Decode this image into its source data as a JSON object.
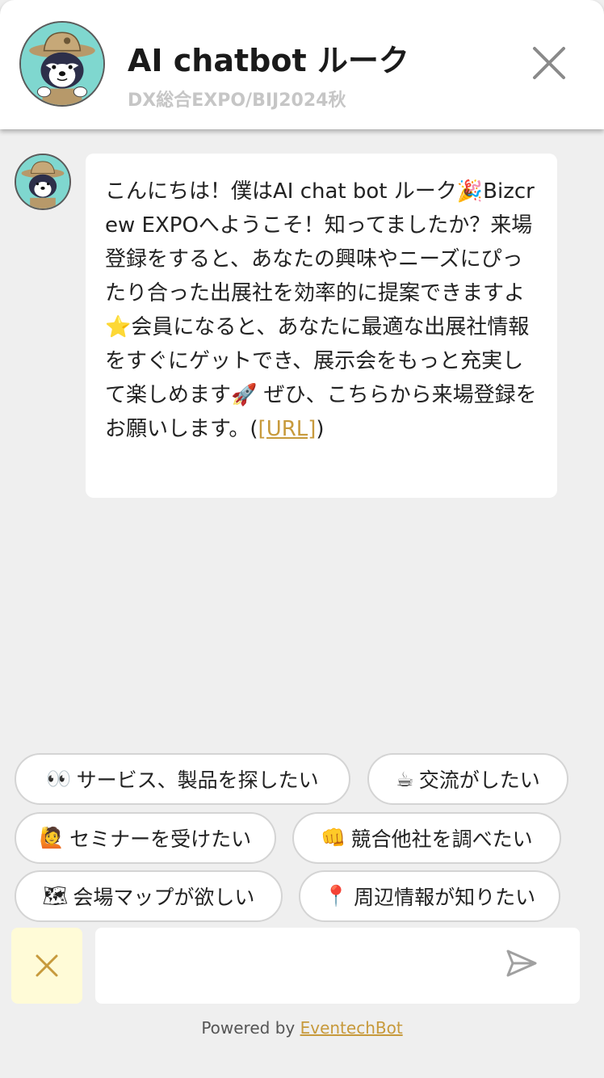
{
  "header": {
    "title": "AI chatbot ルーク",
    "subtitle": "DX総合EXPO/BIJ2024秋",
    "avatar_colors": {
      "background": "#7fd7cf",
      "hat": "#b7996a"
    }
  },
  "message": {
    "text_before_link": "こんにちは！僕はAI chat bot ルーク🎉Bizcrew EXPOへようこそ！知ってましたか？来場登録をすると、あなたの興味やニーズにぴったり合った出展社を効率的に提案できますよ⭐会員になると、あなたに最適な出展社情報をすぐにゲットでき、展示会をもっと充実して楽しめます🚀 ぜひ、こちらから来場登録をお願いします。(",
    "link_text": "[URL]",
    "text_after_link": ")"
  },
  "quick_replies": [
    {
      "emoji": "👀",
      "label": "サービス、製品を探したい"
    },
    {
      "emoji": "☕",
      "label": "交流がしたい"
    },
    {
      "emoji": "🙋",
      "label": "セミナーを受けたい"
    },
    {
      "emoji": "👊",
      "label": "競合他社を調べたい"
    },
    {
      "emoji": "🗺",
      "label": "会場マップが欲しい"
    },
    {
      "emoji": "📍",
      "label": "周辺情報が知りたい"
    }
  ],
  "input": {
    "value": "",
    "placeholder": ""
  },
  "footer": {
    "powered_text": "Powered by",
    "brand": "EventechBot"
  },
  "colors": {
    "accent": "#c79a3c",
    "clear_button_bg": "#fffbd7",
    "page_bg": "#efefef"
  },
  "icons": {
    "close": "close-x-icon",
    "clear": "clear-x-icon",
    "send": "send-paper-plane-icon"
  }
}
